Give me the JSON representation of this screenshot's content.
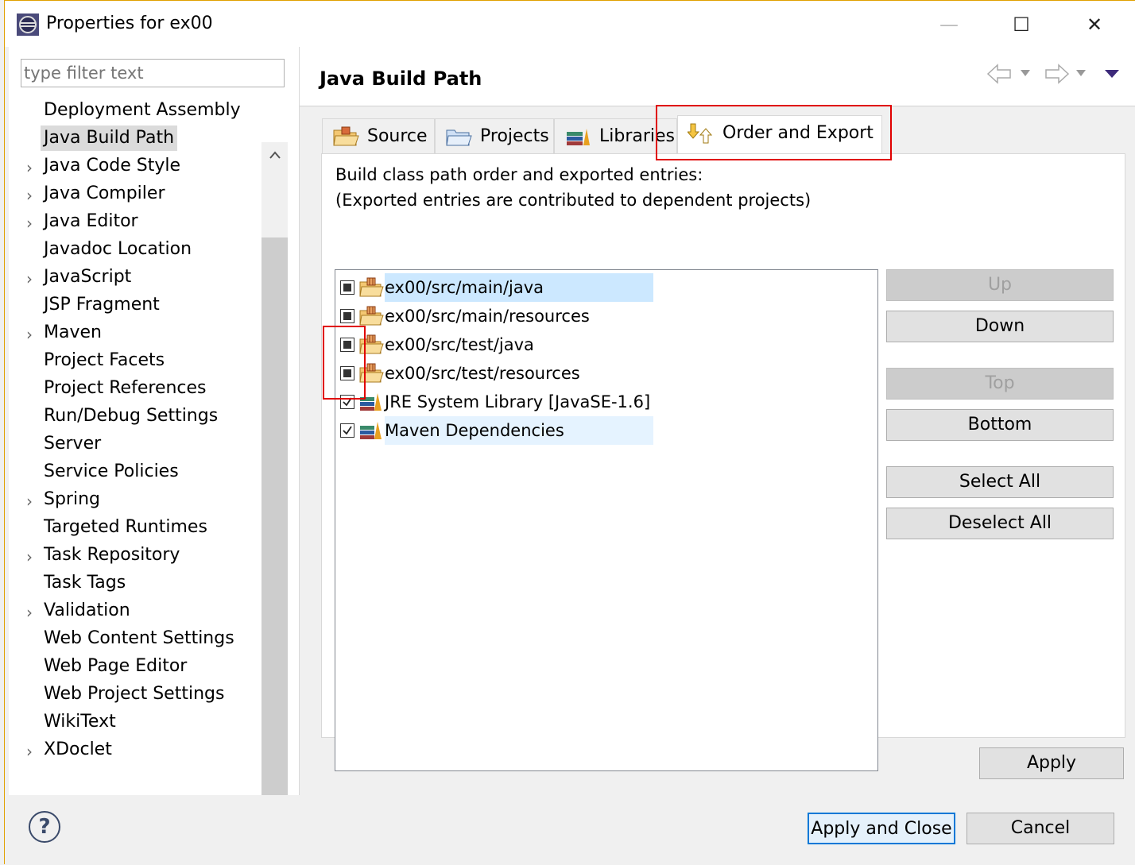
{
  "window": {
    "title": "Properties for ex00",
    "minimize_glyph": "—",
    "maximize_glyph": "☐",
    "close_glyph": "✕"
  },
  "filter": {
    "placeholder": "type filter text"
  },
  "tree": {
    "items": [
      {
        "label": "Deployment Assembly",
        "expandable": false,
        "selected": false
      },
      {
        "label": "Java Build Path",
        "expandable": false,
        "selected": true
      },
      {
        "label": "Java Code Style",
        "expandable": true,
        "selected": false
      },
      {
        "label": "Java Compiler",
        "expandable": true,
        "selected": false
      },
      {
        "label": "Java Editor",
        "expandable": true,
        "selected": false
      },
      {
        "label": "Javadoc Location",
        "expandable": false,
        "selected": false
      },
      {
        "label": "JavaScript",
        "expandable": true,
        "selected": false
      },
      {
        "label": "JSP Fragment",
        "expandable": false,
        "selected": false
      },
      {
        "label": "Maven",
        "expandable": true,
        "selected": false
      },
      {
        "label": "Project Facets",
        "expandable": false,
        "selected": false
      },
      {
        "label": "Project References",
        "expandable": false,
        "selected": false
      },
      {
        "label": "Run/Debug Settings",
        "expandable": false,
        "selected": false
      },
      {
        "label": "Server",
        "expandable": false,
        "selected": false
      },
      {
        "label": "Service Policies",
        "expandable": false,
        "selected": false
      },
      {
        "label": "Spring",
        "expandable": true,
        "selected": false
      },
      {
        "label": "Targeted Runtimes",
        "expandable": false,
        "selected": false
      },
      {
        "label": "Task Repository",
        "expandable": true,
        "selected": false
      },
      {
        "label": "Task Tags",
        "expandable": false,
        "selected": false
      },
      {
        "label": "Validation",
        "expandable": true,
        "selected": false
      },
      {
        "label": "Web Content Settings",
        "expandable": false,
        "selected": false
      },
      {
        "label": "Web Page Editor",
        "expandable": false,
        "selected": false
      },
      {
        "label": "Web Project Settings",
        "expandable": false,
        "selected": false
      },
      {
        "label": "WikiText",
        "expandable": false,
        "selected": false
      },
      {
        "label": "XDoclet",
        "expandable": true,
        "selected": false
      }
    ]
  },
  "page": {
    "title": "Java Build Path",
    "tabs": [
      {
        "label": "Source",
        "icon": "source-folder-icon"
      },
      {
        "label": "Projects",
        "icon": "projects-icon"
      },
      {
        "label": "Libraries",
        "icon": "libraries-icon"
      },
      {
        "label": "Order and Export",
        "icon": "order-export-icon",
        "active": true
      }
    ],
    "description_line1": "Build class path order and exported entries:",
    "description_line2": "(Exported entries are contributed to dependent projects)",
    "entries": [
      {
        "label": "ex00/src/main/java",
        "checkbox": "fixed",
        "icon": "package-folder-icon",
        "highlight": "selected"
      },
      {
        "label": "ex00/src/main/resources",
        "checkbox": "fixed",
        "icon": "package-folder-icon",
        "highlight": "none"
      },
      {
        "label": "ex00/src/test/java",
        "checkbox": "fixed",
        "icon": "package-folder-icon",
        "highlight": "none"
      },
      {
        "label": "ex00/src/test/resources",
        "checkbox": "fixed",
        "icon": "package-folder-icon",
        "highlight": "none"
      },
      {
        "label": "JRE System Library [JavaSE-1.6]",
        "checkbox": "checked",
        "icon": "library-icon",
        "highlight": "none"
      },
      {
        "label": "Maven Dependencies",
        "checkbox": "checked",
        "icon": "library-icon",
        "highlight": "hover"
      }
    ],
    "buttons": {
      "up": "Up",
      "down": "Down",
      "top": "Top",
      "bottom": "Bottom",
      "select_all": "Select All",
      "deselect_all": "Deselect All"
    },
    "apply": "Apply"
  },
  "footer": {
    "help_glyph": "?",
    "apply_close": "Apply and Close",
    "cancel": "Cancel"
  },
  "colors": {
    "selection": "#cce8ff",
    "hover": "#e5f3ff",
    "highlight_box": "#e00000",
    "disabled_text": "#a0a0a0"
  }
}
